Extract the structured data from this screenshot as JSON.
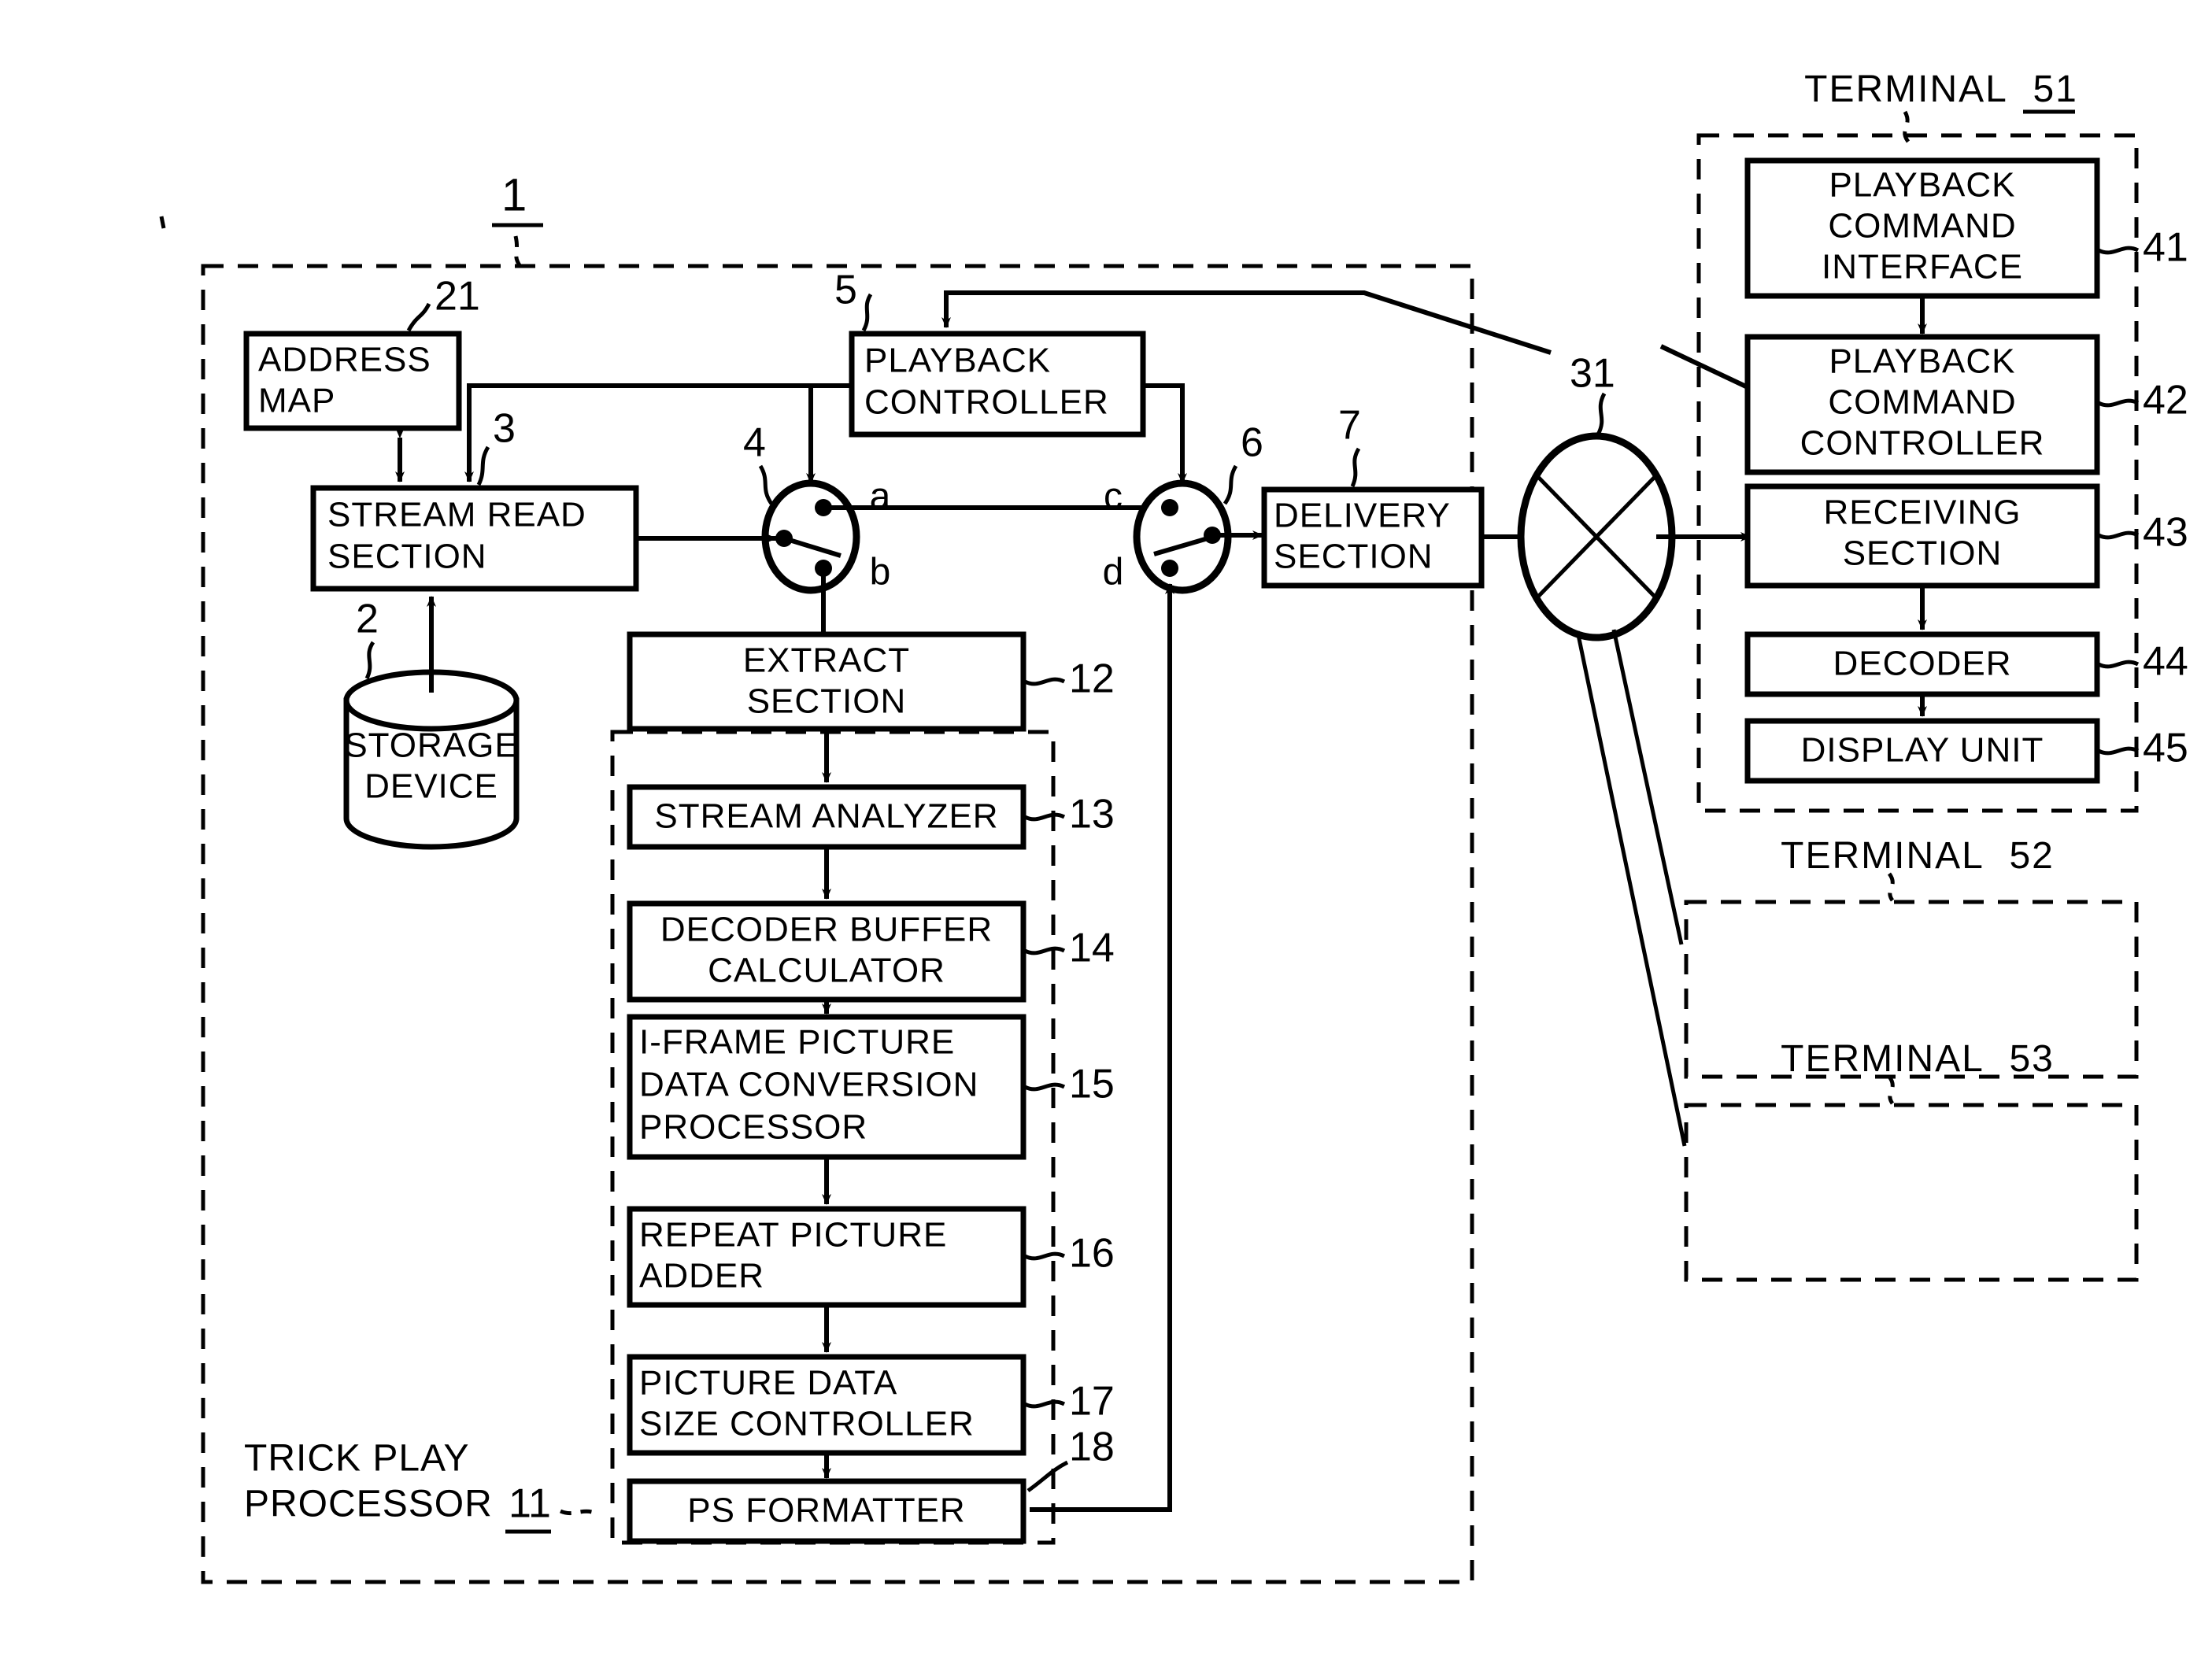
{
  "figure": {
    "type": "patent-block-diagram",
    "server": {
      "ref": "1",
      "label_trick_play": "TRICK PLAY",
      "label_trick_play_2": "PROCESSOR",
      "trick_play_ref": "11"
    },
    "blocks": [
      {
        "id": "address-map",
        "label": "ADDRESS\nMAP",
        "lines": [
          "ADDRESS",
          "MAP"
        ],
        "ref": "21"
      },
      {
        "id": "stream-read-section",
        "label": "STREAM  READ\nSECTION",
        "lines": [
          "STREAM  READ",
          "SECTION"
        ],
        "ref": "3"
      },
      {
        "id": "storage-device",
        "label": "STORAGE\nDEVICE",
        "lines": [
          "STORAGE",
          "DEVICE"
        ],
        "ref": "2"
      },
      {
        "id": "playback-controller",
        "label": "PLAYBACK\nCONTROLLER",
        "lines": [
          "PLAYBACK",
          "CONTROLLER"
        ],
        "ref": "5"
      },
      {
        "id": "extract-section",
        "label": "EXTRACT\nSECTION",
        "lines": [
          "EXTRACT",
          "SECTION"
        ],
        "ref": "12"
      },
      {
        "id": "stream-analyzer",
        "label": "STREAM  ANALYZER",
        "lines": [
          "STREAM  ANALYZER"
        ],
        "ref": "13"
      },
      {
        "id": "decoder-buffer-calculator",
        "label": "DECODER  BUFFER\nCALCULATOR",
        "lines": [
          "DECODER  BUFFER",
          "CALCULATOR"
        ],
        "ref": "14"
      },
      {
        "id": "i-frame-picture-data-conversion-processor",
        "label": "I-FRAME PICTURE\nDATA CONVERSION\nPROCESSOR",
        "lines": [
          "I-FRAME PICTURE",
          "DATA CONVERSION",
          "PROCESSOR"
        ],
        "ref": "15"
      },
      {
        "id": "repeat-picture-adder",
        "label": "REPEAT PICTURE\nADDER",
        "lines": [
          "REPEAT PICTURE",
          "ADDER"
        ],
        "ref": "16"
      },
      {
        "id": "picture-data-size-controller",
        "label": "PICTURE DATA\nSIZE CONTROLLER",
        "lines": [
          "PICTURE DATA",
          "SIZE CONTROLLER"
        ],
        "ref": "17"
      },
      {
        "id": "ps-formatter",
        "label": "PS FORMATTER",
        "lines": [
          "PS FORMATTER"
        ],
        "ref": "18"
      },
      {
        "id": "delivery-section",
        "label": "DELIVERY\nSECTION",
        "lines": [
          "DELIVERY",
          "SECTION"
        ],
        "ref": "7"
      }
    ],
    "switches": [
      {
        "id": "switch-4",
        "ref": "4",
        "ports": [
          "a",
          "b"
        ]
      },
      {
        "id": "switch-6",
        "ref": "6",
        "ports": [
          "c",
          "d"
        ]
      }
    ],
    "network": {
      "id": "network-cloud",
      "ref": "31"
    },
    "terminals": [
      {
        "id": "terminal-51",
        "title": "TERMINAL",
        "number": "51",
        "underlined": true,
        "blocks": [
          {
            "id": "playback-command-interface",
            "lines": [
              "PLAYBACK",
              "COMMAND",
              "INTERFACE"
            ],
            "ref": "41"
          },
          {
            "id": "playback-command-controller",
            "lines": [
              "PLAYBACK",
              "COMMAND",
              "CONTROLLER"
            ],
            "ref": "42"
          },
          {
            "id": "receiving-section",
            "lines": [
              "RECEIVING",
              "SECTION"
            ],
            "ref": "43"
          },
          {
            "id": "decoder",
            "lines": [
              "DECODER"
            ],
            "ref": "44"
          },
          {
            "id": "display-unit",
            "lines": [
              "DISPLAY  UNIT"
            ],
            "ref": "45"
          }
        ]
      },
      {
        "id": "terminal-52",
        "title": "TERMINAL",
        "number": "52",
        "underlined": false,
        "blocks": []
      },
      {
        "id": "terminal-53",
        "title": "TERMINAL",
        "number": "53",
        "underlined": false,
        "blocks": []
      }
    ],
    "colors": {
      "ink": "#000000",
      "paper": "#ffffff"
    }
  }
}
